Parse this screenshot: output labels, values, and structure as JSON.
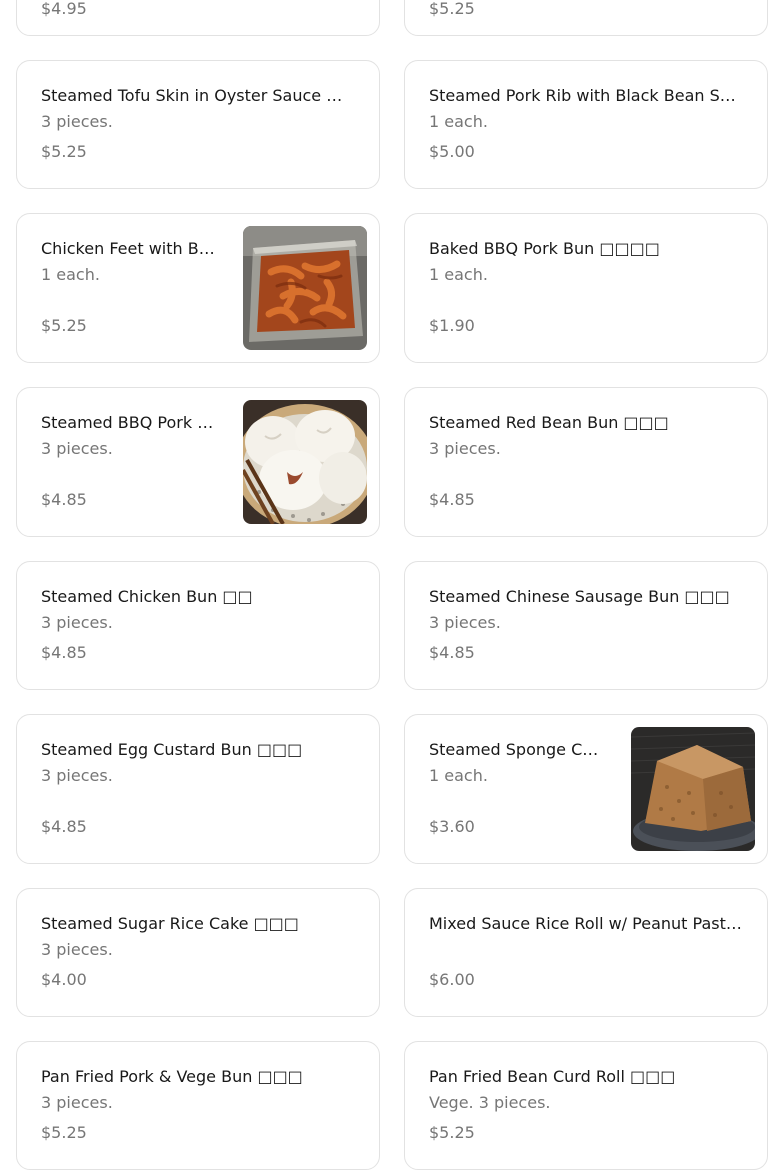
{
  "items": [
    {
      "price": "$4.95"
    },
    {
      "price": "$5.25"
    },
    {
      "name": "Steamed Tofu Skin in Oyster Sauce □□□",
      "desc": "3 pieces.",
      "price": "$5.25"
    },
    {
      "name": "Steamed Pork Rib with Black Bean Sauce □□□",
      "desc": "1 each.",
      "price": "$5.00"
    },
    {
      "name": "Chicken Feet with Black Bean Sauce □□□",
      "desc": "1 each.",
      "price": "$5.25",
      "image": "chicken-feet-photo"
    },
    {
      "name": "Baked BBQ Pork Bun □□□□",
      "desc": "1 each.",
      "price": "$1.90"
    },
    {
      "name": "Steamed BBQ Pork Bun □□□",
      "desc": "3 pieces.",
      "price": "$4.85",
      "image": "bbq-pork-bun-photo"
    },
    {
      "name": "Steamed Red Bean Bun □□□",
      "desc": "3 pieces.",
      "price": "$4.85"
    },
    {
      "name": "Steamed Chicken Bun □□",
      "desc": "3 pieces.",
      "price": "$4.85"
    },
    {
      "name": "Steamed Chinese Sausage Bun □□□",
      "desc": "3 pieces.",
      "price": "$4.85"
    },
    {
      "name": "Steamed Egg Custard Bun □□□",
      "desc": "3 pieces.",
      "price": "$4.85"
    },
    {
      "name": "Steamed Sponge Cake □□□",
      "desc": "1 each.",
      "price": "$3.60",
      "image": "sponge-cake-photo"
    },
    {
      "name": "Steamed Sugar Rice Cake □□□",
      "desc": "3 pieces.",
      "price": "$4.00"
    },
    {
      "name": "Mixed Sauce Rice Roll w/ Peanut Paste □□□",
      "desc": "",
      "price": "$6.00"
    },
    {
      "name": "Pan Fried Pork & Vege Bun □□□",
      "desc": "3 pieces.",
      "price": "$5.25"
    },
    {
      "name": "Pan Fried Bean Curd Roll □□□",
      "desc": "Vege. 3 pieces.",
      "price": "$5.25"
    }
  ]
}
